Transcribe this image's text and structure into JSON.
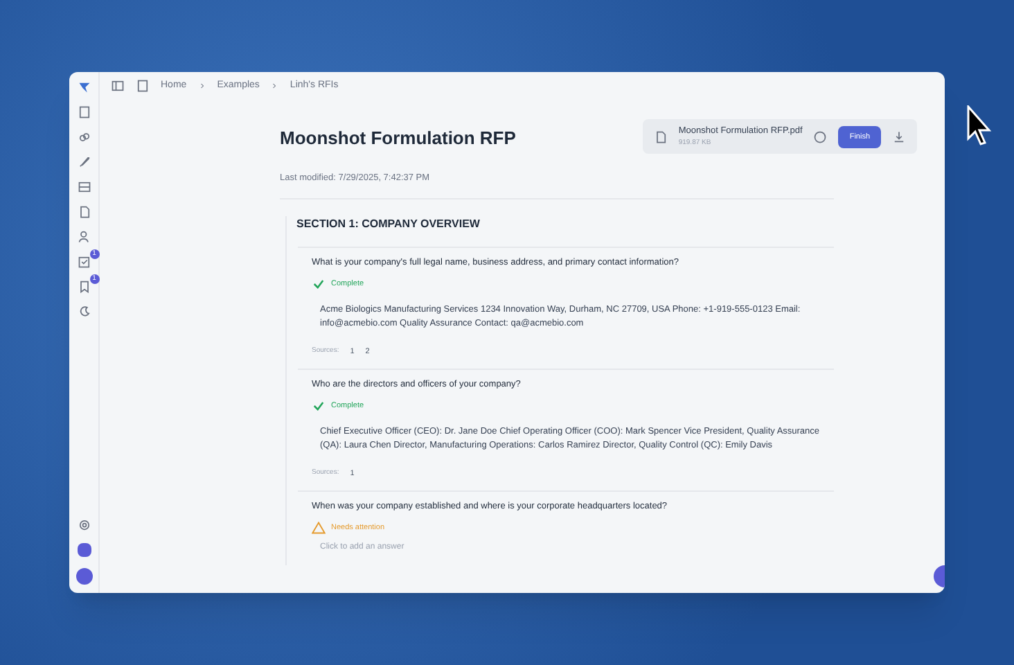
{
  "breadcrumb": [
    "Home",
    "Examples",
    "Linh's RFIs"
  ],
  "sidebar": {
    "badges": [
      "1",
      "1"
    ]
  },
  "document": {
    "title": "Moonshot Formulation RFP",
    "last_modified": "Last modified: 7/29/2025, 7:42:37 PM"
  },
  "file": {
    "name": "Moonshot Formulation RFP.pdf",
    "size": "919.87 KB",
    "finish_label": "Finish"
  },
  "section": {
    "title": "SECTION 1: COMPANY OVERVIEW",
    "questions": [
      {
        "question": "What is your company's full legal name, business address, and primary contact information?",
        "status": {
          "kind": "complete",
          "label": "Complete"
        },
        "answer": "Acme Biologics Manufacturing Services 1234 Innovation Way, Durham, NC 27709, USA Phone: +1-919-555-0123 Email: info@acmebio.com Quality Assurance Contact: qa@acmebio.com",
        "sources_label": "Sources:",
        "sources": [
          "1",
          "2"
        ]
      },
      {
        "question": "Who are the directors and officers of your company?",
        "status": {
          "kind": "complete",
          "label": "Complete"
        },
        "answer": "Chief Executive Officer (CEO): Dr. Jane Doe Chief Operating Officer (COO): Mark Spencer Vice President, Quality Assurance (QA): Laura Chen Director, Manufacturing Operations: Carlos Ramirez Director, Quality Control (QC): Emily Davis",
        "sources_label": "Sources:",
        "sources": [
          "1"
        ]
      },
      {
        "question": "When was your company established and where is your corporate headquarters located?",
        "status": {
          "kind": "attention",
          "label": "Needs attention"
        },
        "placeholder": "Click to add an answer"
      }
    ]
  }
}
